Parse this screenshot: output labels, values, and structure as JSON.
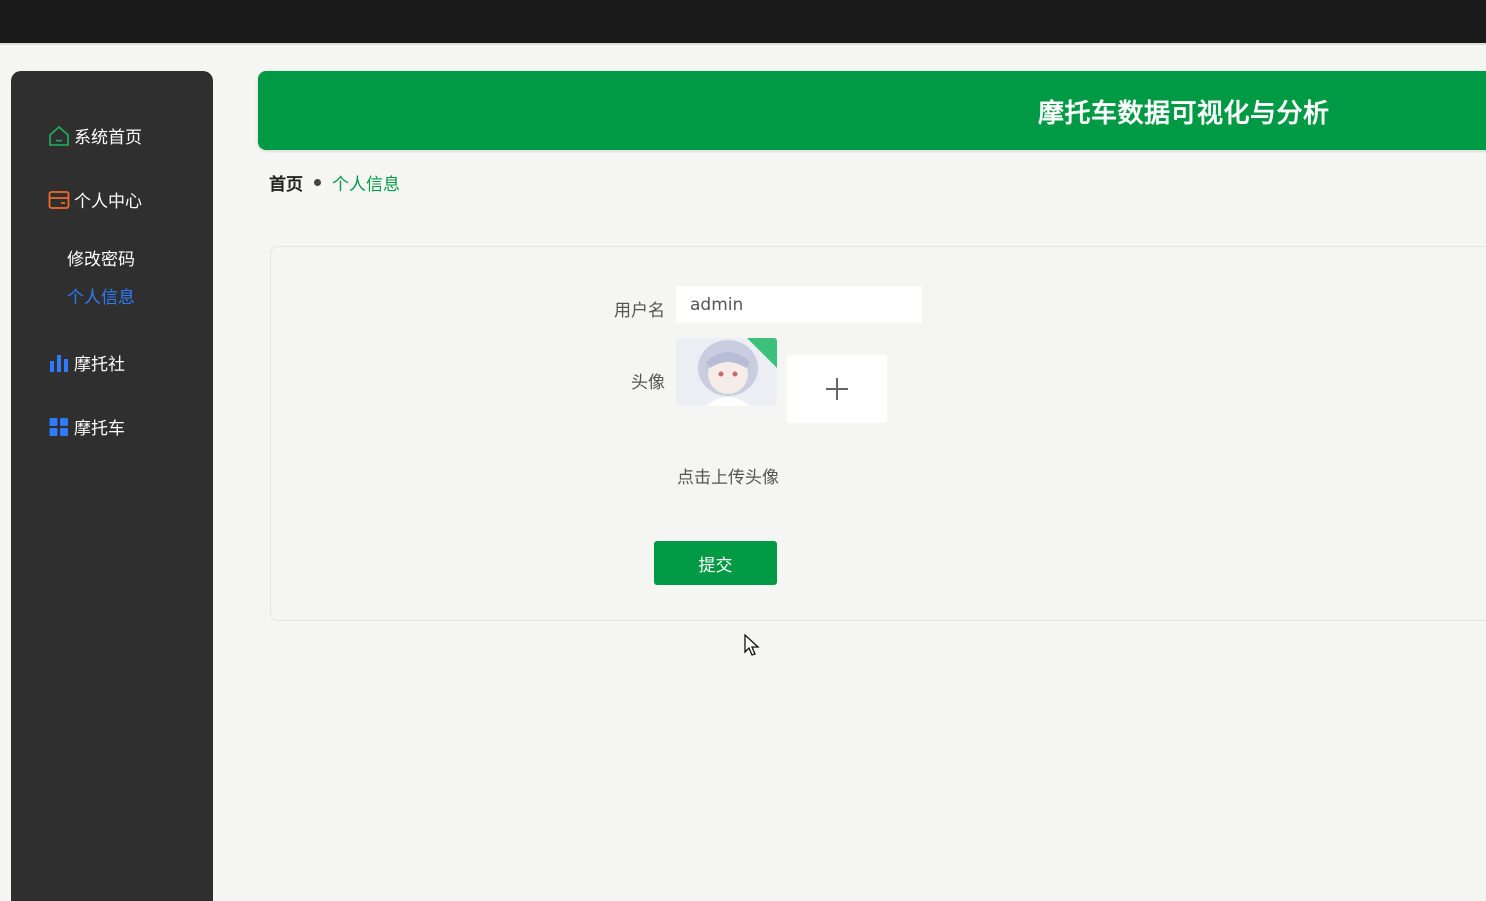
{
  "header": {
    "title": "摩托车数据可视化与分析"
  },
  "sidebar": {
    "items": [
      {
        "label": "系统首页",
        "icon": "home-icon"
      },
      {
        "label": "个人中心",
        "icon": "wallet-icon"
      },
      {
        "label": "摩托社",
        "icon": "bar-chart-icon"
      },
      {
        "label": "摩托车",
        "icon": "grid-icon"
      }
    ],
    "sub_items": [
      {
        "label": "修改密码",
        "active": false
      },
      {
        "label": "个人信息",
        "active": true
      }
    ]
  },
  "breadcrumb": {
    "home": "首页",
    "current": "个人信息"
  },
  "form": {
    "username_label": "用户名",
    "username_value": "admin",
    "avatar_label": "头像",
    "upload_hint": "点击上传头像",
    "submit_label": "提交"
  },
  "colors": {
    "brand_green": "#009a44",
    "sidebar_bg": "#2f2f2f",
    "active_link": "#2f7bff",
    "page_bg": "#f5f5f4"
  }
}
